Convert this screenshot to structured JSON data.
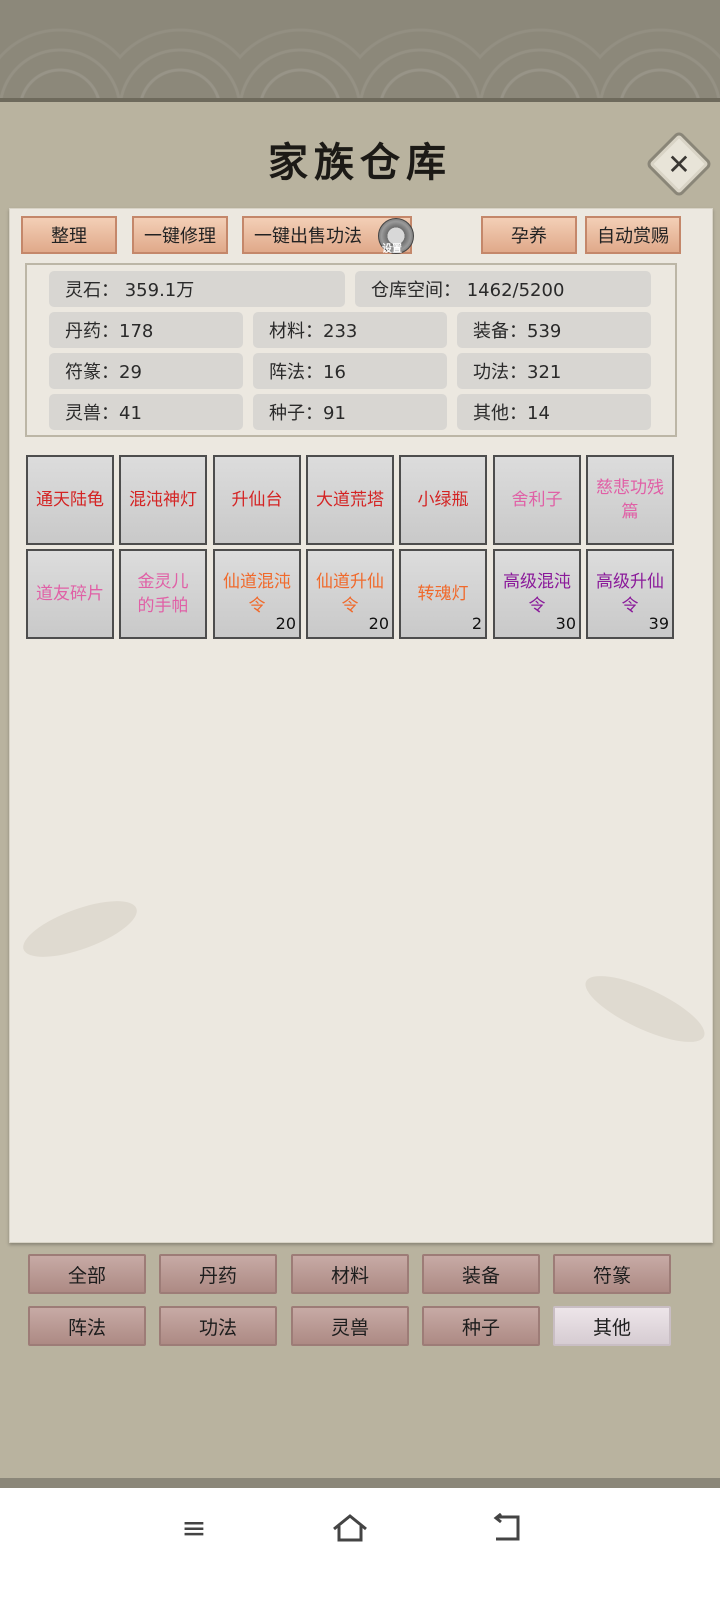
{
  "title": "家族仓库",
  "toolbar": {
    "buttons": [
      "整理",
      "一键修理",
      "一键出售功法",
      "孕养",
      "自动赏赐"
    ],
    "gear_label": "设置"
  },
  "stats": {
    "lingshi": "灵石：  359.1万",
    "space": "仓库空间：   1462/5200",
    "danyao": "丹药：178",
    "cailiao": "材料：233",
    "zhuangbei": "装备：539",
    "fuzhuan": "符篆：29",
    "zhenfa": "阵法：16",
    "gongfa": "功法：321",
    "lingshou": "灵兽：41",
    "zhongzi": "种子：91",
    "qita": "其他：14"
  },
  "items": [
    {
      "name": "通天陆龟",
      "count": "",
      "color": "red"
    },
    {
      "name": "混沌神灯",
      "count": "",
      "color": "red"
    },
    {
      "name": "升仙台",
      "count": "",
      "color": "red"
    },
    {
      "name": "大道荒塔",
      "count": "",
      "color": "red"
    },
    {
      "name": "小绿瓶",
      "count": "",
      "color": "red"
    },
    {
      "name": "舍利子",
      "count": "",
      "color": "pink"
    },
    {
      "name": "慈悲功残篇",
      "count": "",
      "color": "pink"
    },
    {
      "name": "道友碎片",
      "count": "",
      "color": "pink"
    },
    {
      "name": "金灵儿的手帕",
      "count": "",
      "color": "pink"
    },
    {
      "name": "仙道混沌令",
      "count": "20",
      "color": "orange"
    },
    {
      "name": "仙道升仙令",
      "count": "20",
      "color": "orange"
    },
    {
      "name": "转魂灯",
      "count": "2",
      "color": "orange"
    },
    {
      "name": "高级混沌令",
      "count": "30",
      "color": "purple"
    },
    {
      "name": "高级升仙令",
      "count": "39",
      "color": "purple"
    }
  ],
  "categories": [
    "全部",
    "丹药",
    "材料",
    "装备",
    "符篆",
    "阵法",
    "功法",
    "灵兽",
    "种子",
    "其他"
  ],
  "active_category": "其他",
  "colors": {
    "red": "#d42424",
    "pink": "#e060a6",
    "orange": "#f06a2c",
    "purple": "#8a1a9a"
  },
  "nav": {
    "icons": [
      "menu-icon",
      "home-icon",
      "back-icon"
    ]
  }
}
